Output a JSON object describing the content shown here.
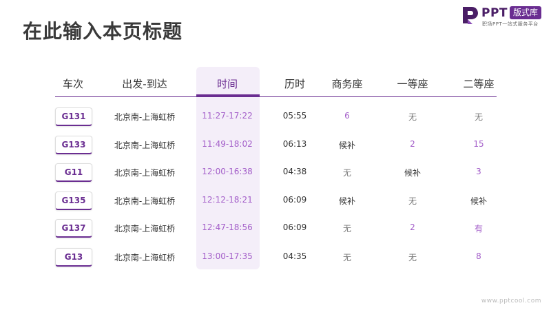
{
  "page": {
    "title": "在此输入本页标题"
  },
  "logo": {
    "icon": "ppt-logo-icon",
    "brand": "PPT",
    "badge": "版式库",
    "tagline": "职场PPT一站式服务平台"
  },
  "table": {
    "headers": [
      "车次",
      "出发-到达",
      "时间",
      "历时",
      "商务座",
      "一等座",
      "二等座"
    ],
    "active_header_index": 2,
    "rows": [
      {
        "train": "G131",
        "route": "北京南-上海虹桥",
        "time": "11:27-17:22",
        "duration": "05:55",
        "business": "6",
        "first": "无",
        "second": "无"
      },
      {
        "train": "G133",
        "route": "北京南-上海虹桥",
        "time": "11:49-18:02",
        "duration": "06:13",
        "business": "候补",
        "first": "2",
        "second": "15"
      },
      {
        "train": "G11",
        "route": "北京南-上海虹桥",
        "time": "12:00-16:38",
        "duration": "04:38",
        "business": "无",
        "first": "候补",
        "second": "3"
      },
      {
        "train": "G135",
        "route": "北京南-上海虹桥",
        "time": "12:12-18:21",
        "duration": "06:09",
        "business": "候补",
        "first": "无",
        "second": "候补"
      },
      {
        "train": "G137",
        "route": "北京南-上海虹桥",
        "time": "12:47-18:56",
        "duration": "06:09",
        "business": "无",
        "first": "2",
        "second": "有"
      },
      {
        "train": "G13",
        "route": "北京南-上海虹桥",
        "time": "13:00-17:35",
        "duration": "04:35",
        "business": "无",
        "first": "无",
        "second": "8"
      }
    ]
  },
  "watermark": "www.pptcool.com",
  "colors": {
    "accent": "#6a2d91",
    "highlight": "#f4eef9",
    "value_purple": "#a35ec9"
  }
}
